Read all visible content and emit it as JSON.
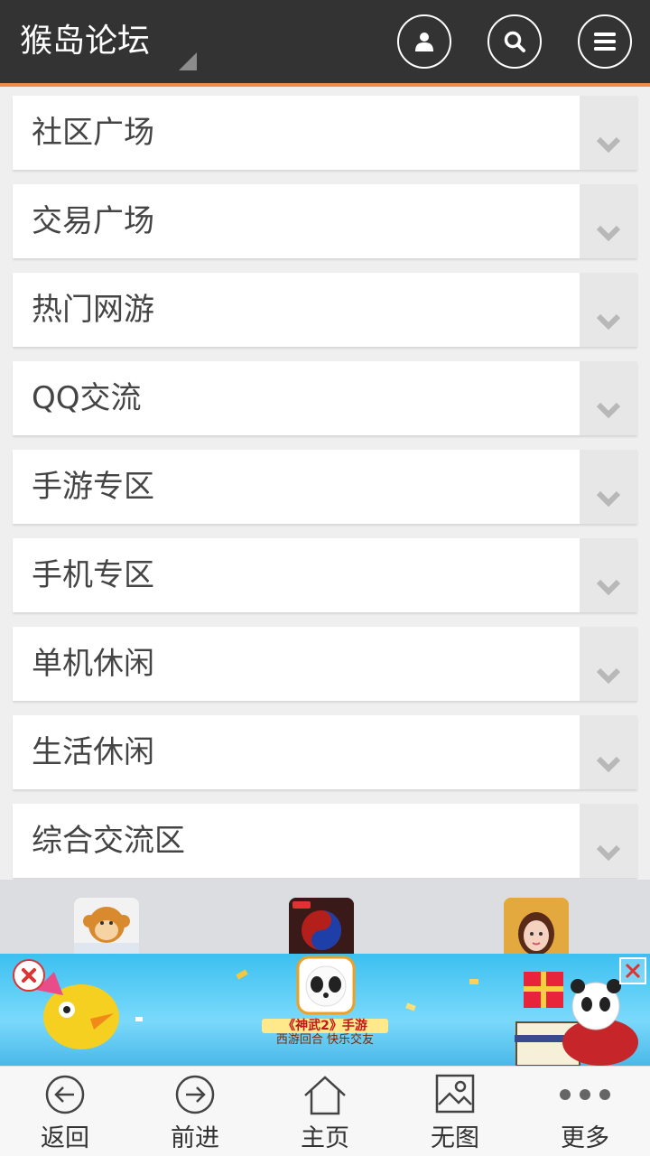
{
  "header": {
    "title": "猴岛论坛",
    "buttons": [
      {
        "icon": "user-icon"
      },
      {
        "icon": "search-icon"
      },
      {
        "icon": "menu-icon"
      }
    ]
  },
  "colors": {
    "header_bg": "#333333",
    "accent": "#f08a4b",
    "list_bg": "#efefef",
    "toggle_bg": "#e7e7e7",
    "text": "#444444"
  },
  "categories": [
    {
      "label": "社区广场"
    },
    {
      "label": "交易广场"
    },
    {
      "label": "热门网游"
    },
    {
      "label": "QQ交流"
    },
    {
      "label": "手游专区"
    },
    {
      "label": "手机专区"
    },
    {
      "label": "单机休闲"
    },
    {
      "label": "生活休闲"
    },
    {
      "label": "综合交流区"
    }
  ],
  "app_strip": {
    "icons": [
      "monkey-logo-icon",
      "game-app-icon",
      "character-app-icon"
    ]
  },
  "ad": {
    "line1": "《神武2》手游",
    "line2": "西游回合 快乐交友"
  },
  "toolbar": {
    "items": [
      {
        "label": "返回",
        "icon": "back-arrow-icon"
      },
      {
        "label": "前进",
        "icon": "forward-arrow-icon"
      },
      {
        "label": "主页",
        "icon": "home-icon"
      },
      {
        "label": "无图",
        "icon": "no-image-icon"
      },
      {
        "label": "更多",
        "icon": "more-dots-icon"
      }
    ]
  }
}
